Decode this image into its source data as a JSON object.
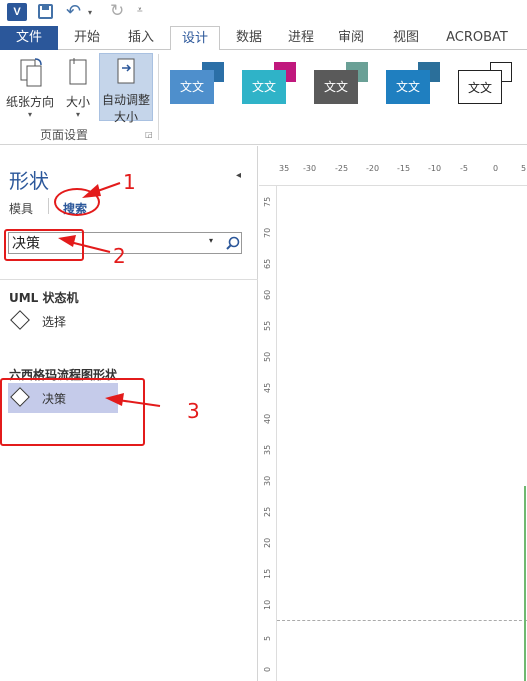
{
  "qat": {
    "app_logo": "V",
    "save_icon": "save-icon",
    "undo_icon": "undo-icon",
    "redo_icon": "redo-icon"
  },
  "tabs": [
    "文件",
    "开始",
    "插入",
    "设计",
    "数据",
    "进程",
    "审阅",
    "视图",
    "ACROBAT"
  ],
  "active_tab": "设计",
  "ribbon": {
    "page_setup": {
      "orientation_label": "纸张方向",
      "size_label": "大小",
      "autofit_label_1": "自动调整",
      "autofit_label_2": "大小",
      "group_label": "页面设置"
    },
    "themes": [
      {
        "label": "文文",
        "front": "#4e8fcc",
        "back": "#2b6fa7"
      },
      {
        "label": "文文",
        "front": "#2fb3c8",
        "back": "#c0187d"
      },
      {
        "label": "文文",
        "front": "#5a5a5a",
        "back": "#6aa096"
      },
      {
        "label": "文文",
        "front": "#1f7fc0",
        "back": "#2b6f9a"
      },
      {
        "label": "文文",
        "front": "#ffffff",
        "back": "#ffffff"
      }
    ]
  },
  "shapes_pane": {
    "title": "形状",
    "tab_stencils": "模具",
    "tab_search": "搜索",
    "search_value": "决策",
    "categories": [
      {
        "title": "UML 状态机",
        "item": "选择"
      },
      {
        "title": "六西格玛流程图形状",
        "item": "决策"
      }
    ]
  },
  "annotations": [
    "1",
    "2",
    "3"
  ],
  "ruler": {
    "h_ticks": [
      "35",
      "-30",
      "-25",
      "-20",
      "-15",
      "-10",
      "-5",
      "0",
      "5"
    ],
    "v_ticks": [
      "75",
      "70",
      "65",
      "60",
      "55",
      "50",
      "45",
      "40",
      "35",
      "30",
      "25",
      "20",
      "15",
      "10",
      "5",
      "0"
    ]
  },
  "colors": {
    "accent": "#2b579a",
    "annotation": "#e31b1b",
    "selected": "#c5cbea"
  }
}
